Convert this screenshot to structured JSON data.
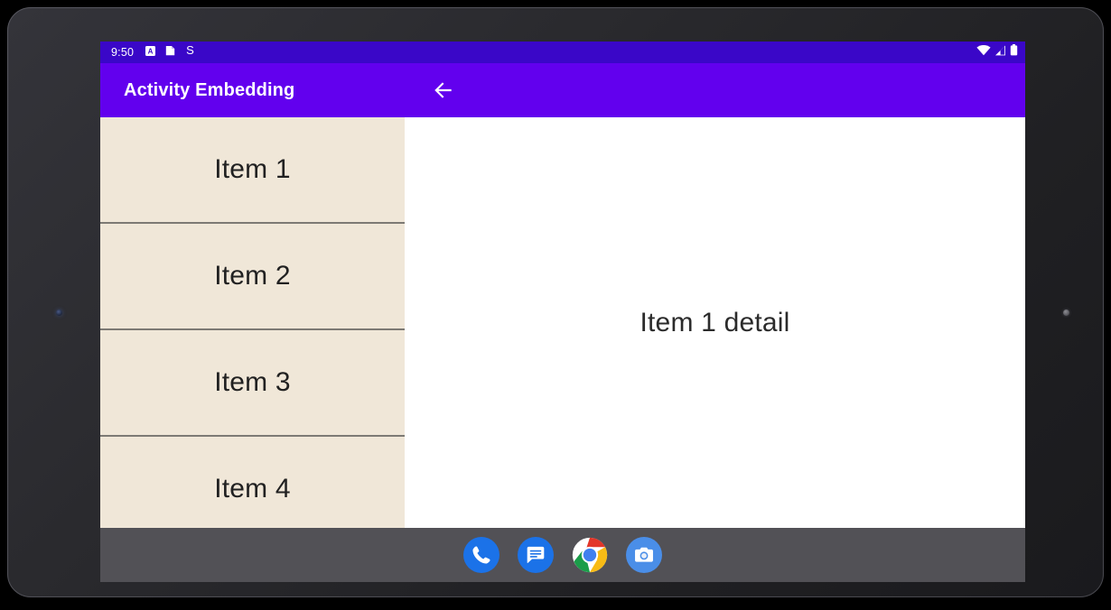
{
  "device": {
    "name": "android-tablet-frame",
    "camera_dot": "camera-dot",
    "sensor_dot": "sensor-dot"
  },
  "status_bar": {
    "clock": "9:50",
    "background_color": "#3A07C8",
    "left_icons": [
      {
        "name": "app-notification-icon",
        "glyph": "A"
      },
      {
        "name": "clipboard-notification-icon",
        "glyph": ""
      },
      {
        "name": "sync-notification-icon",
        "glyph": "S"
      }
    ],
    "right_icons": [
      {
        "name": "wifi-icon"
      },
      {
        "name": "cellular-signal-icon"
      },
      {
        "name": "battery-icon"
      }
    ]
  },
  "app_bar": {
    "title": "Activity Embedding",
    "background_color": "#6200EE",
    "back_arrow": "←"
  },
  "list_pane": {
    "background_color": "#F0E7D8",
    "items": [
      {
        "label": "Item 1"
      },
      {
        "label": "Item 2"
      },
      {
        "label": "Item 3"
      },
      {
        "label": "Item 4"
      }
    ]
  },
  "detail_pane": {
    "text": "Item 1 detail",
    "background_color": "#FFFFFF"
  },
  "nav_bar": {
    "background_color": "#525156",
    "apps": [
      {
        "name": "phone-app-icon",
        "label": "Phone"
      },
      {
        "name": "messages-app-icon",
        "label": "Messages"
      },
      {
        "name": "chrome-app-icon",
        "label": "Chrome"
      },
      {
        "name": "camera-app-icon",
        "label": "Camera"
      }
    ]
  }
}
